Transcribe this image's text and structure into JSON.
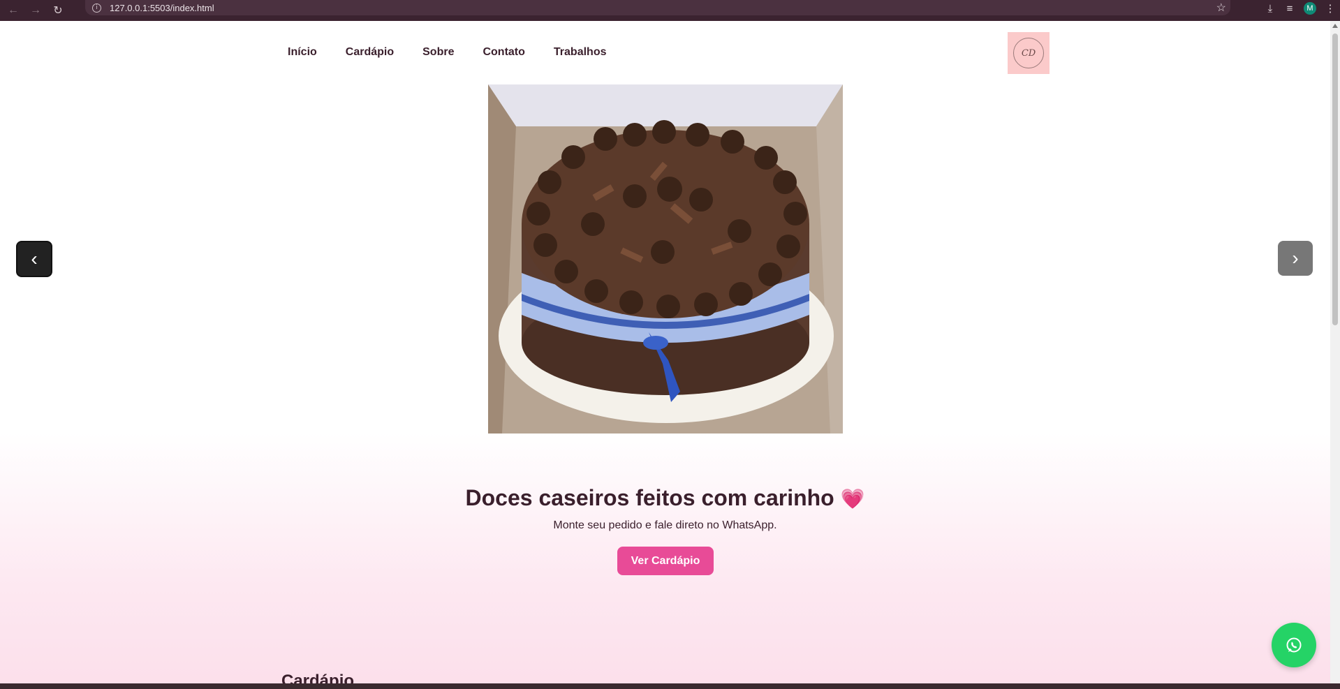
{
  "browser": {
    "url": "127.0.0.1:5503/index.html",
    "profile_initial": "M",
    "icons": [
      "back-icon",
      "forward-icon",
      "reload-icon",
      "info-icon",
      "star-icon",
      "download-icon",
      "media-icon",
      "menu-icon"
    ]
  },
  "nav": {
    "items": [
      "Início",
      "Cardápio",
      "Sobre",
      "Contato",
      "Trabalhos"
    ]
  },
  "logo": {
    "monogram": "CD"
  },
  "carousel": {
    "prev": "‹",
    "next": "›"
  },
  "hero": {
    "headline": "Doces caseiros feitos com carinho",
    "emoji": "💗",
    "subtitle": "Monte seu pedido e fale direto no WhatsApp.",
    "cta": "Ver Cardápio"
  },
  "next_section": {
    "title": "Cardápio"
  },
  "colors": {
    "accent": "#e84b97",
    "text": "#3a1f2c",
    "whatsapp": "#25d366",
    "logo_bg": "#fbcaca"
  }
}
